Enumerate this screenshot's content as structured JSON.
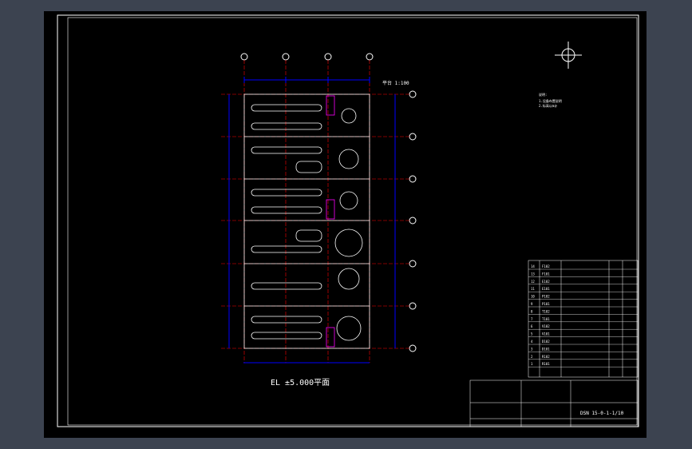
{
  "drawing": {
    "plan_caption": "EL  ±5.000平面",
    "scale_note": "平台 1:100",
    "drawing_number": "DSN 15-0-1-1/10",
    "row_numbers": [
      "14",
      "13",
      "12",
      "11",
      "10",
      "9",
      "8",
      "7",
      "6",
      "5",
      "4",
      "3",
      "2",
      "1"
    ],
    "title_rows": [
      "F102",
      "F101",
      "E102",
      "E101",
      "P102",
      "P101",
      "T102",
      "T101",
      "V102",
      "V101",
      "D102",
      "D101",
      "R102",
      "R101"
    ],
    "header_labels": [
      "序号",
      "位号",
      "设备名称",
      "数量",
      "备注"
    ]
  },
  "colors": {
    "background": "#3c4350",
    "sheet": "#000000",
    "line": "#ffffff",
    "dimension": "#0000ff",
    "grid_axis": "#ff0000",
    "stair": "#ff00ff"
  }
}
